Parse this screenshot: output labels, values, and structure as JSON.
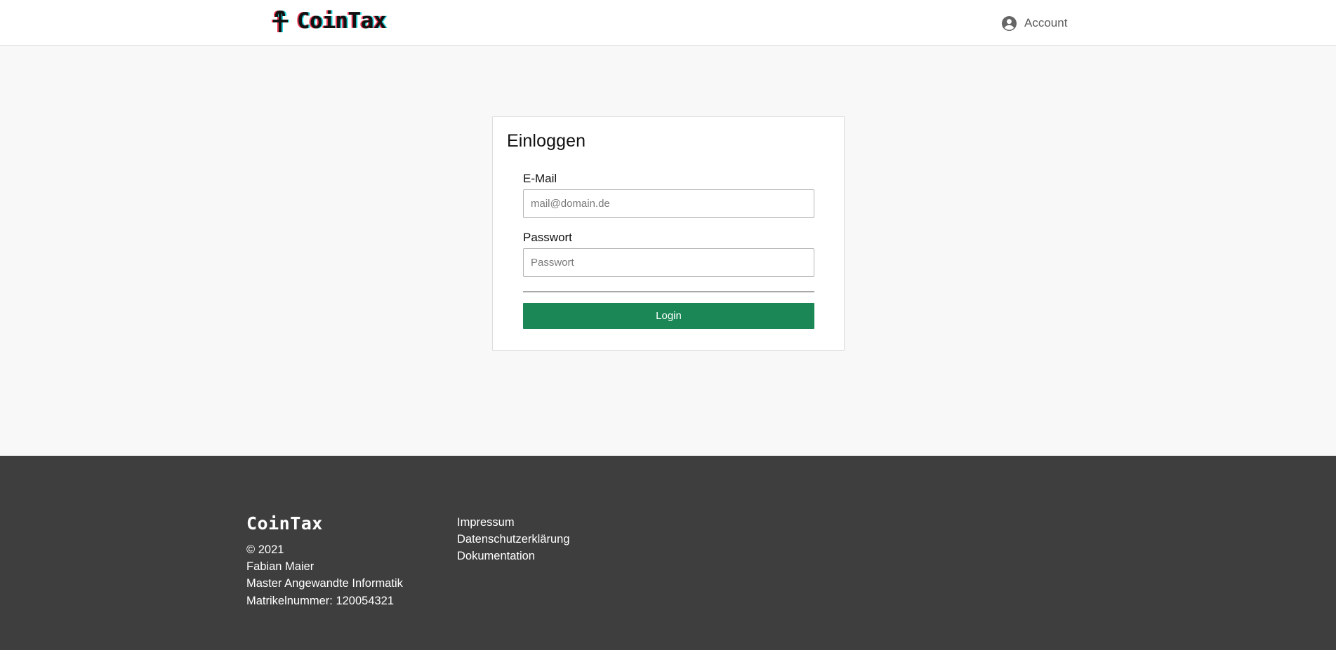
{
  "header": {
    "logo_text": "CoinTax",
    "account_label": "Account",
    "account_icon": "account-circle-icon"
  },
  "login": {
    "title": "Einloggen",
    "email_label": "E-Mail",
    "email_placeholder": "mail@domain.de",
    "email_value": "",
    "password_label": "Passwort",
    "password_placeholder": "Passwort",
    "password_value": "",
    "submit_label": "Login",
    "submit_color": "#1b8757"
  },
  "footer": {
    "brand": "CoinTax",
    "info": [
      "© 2021",
      "Fabian Maier",
      "Master Angewandte Informatik",
      "Matrikelnummer: 120054321"
    ],
    "links": [
      "Impressum",
      "Datenschutzerklärung",
      "Dokumentation"
    ],
    "background_color": "#3e3e3e"
  }
}
